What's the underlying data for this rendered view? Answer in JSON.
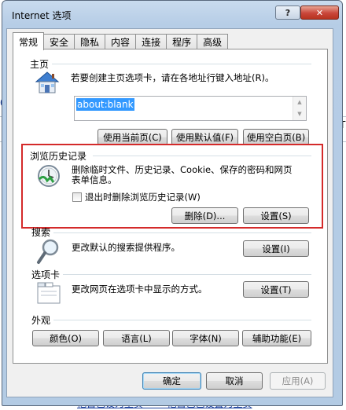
{
  "background": {
    "fragment_left": "0",
    "fragment_right": "T",
    "fragment_bottom": "他自己设为主页        他自己已设置为主页"
  },
  "dialog": {
    "title": "Internet 选项",
    "help_glyph": "?",
    "close_glyph": "✕"
  },
  "tabs": [
    "常规",
    "安全",
    "隐私",
    "内容",
    "连接",
    "程序",
    "高级"
  ],
  "active_tab": "常规",
  "homepage": {
    "title": "主页",
    "description": "若要创建主页选项卡，请在各地址行键入地址(R)。",
    "url_value": "about:blank",
    "buttons": [
      "使用当前页(C)",
      "使用默认值(F)",
      "使用空白页(B)"
    ]
  },
  "history": {
    "title": "浏览历史记录",
    "description_line1": "删除临时文件、历史记录、Cookie、保存的密码和网页",
    "description_line2": "表单信息。",
    "checkbox_label": "退出时删除浏览历史记录(W)",
    "checkbox_checked": false,
    "delete_button": "删除(D)...",
    "settings_button": "设置(S)"
  },
  "search": {
    "title": "搜索",
    "description": "更改默认的搜索提供程序。",
    "settings_button": "设置(I)"
  },
  "tabs_section": {
    "title": "选项卡",
    "description": "更改网页在选项卡中显示的方式。",
    "settings_button": "设置(T)"
  },
  "appearance": {
    "title": "外观",
    "buttons": [
      "颜色(O)",
      "语言(L)",
      "字体(N)",
      "辅助功能(E)"
    ]
  },
  "footer": {
    "ok": "确定",
    "cancel": "取消",
    "apply": "应用(A)"
  },
  "colors": {
    "highlight_border": "#d42a2a",
    "selection": "#3399ff"
  }
}
